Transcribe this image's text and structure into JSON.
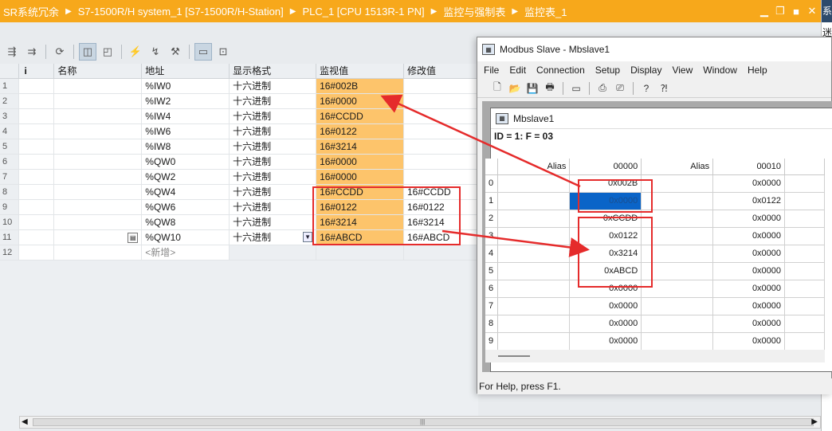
{
  "tia": {
    "title_crumbs": [
      "SR系统冗余",
      "S7-1500R/H system_1 [S7-1500R/H-Station]",
      "PLC_1 [CPU 1513R-1 PN]",
      "监控与强制表",
      "监控表_1"
    ],
    "right_edge_top": "系",
    "right_edge_char": "迷",
    "columns": {
      "info": "i",
      "name": "名称",
      "address": "地址",
      "format": "显示格式",
      "monitor": "监视值",
      "modify": "修改值"
    },
    "rows": [
      {
        "n": "1",
        "address": "%IW0",
        "format": "十六进制",
        "monitor": "16#002B",
        "modify": ""
      },
      {
        "n": "2",
        "address": "%IW2",
        "format": "十六进制",
        "monitor": "16#0000",
        "modify": ""
      },
      {
        "n": "3",
        "address": "%IW4",
        "format": "十六进制",
        "monitor": "16#CCDD",
        "modify": ""
      },
      {
        "n": "4",
        "address": "%IW6",
        "format": "十六进制",
        "monitor": "16#0122",
        "modify": ""
      },
      {
        "n": "5",
        "address": "%IW8",
        "format": "十六进制",
        "monitor": "16#3214",
        "modify": ""
      },
      {
        "n": "6",
        "address": "%QW0",
        "format": "十六进制",
        "monitor": "16#0000",
        "modify": ""
      },
      {
        "n": "7",
        "address": "%QW2",
        "format": "十六进制",
        "monitor": "16#0000",
        "modify": ""
      },
      {
        "n": "8",
        "address": "%QW4",
        "format": "十六进制",
        "monitor": "16#CCDD",
        "modify": "16#CCDD"
      },
      {
        "n": "9",
        "address": "%QW6",
        "format": "十六进制",
        "monitor": "16#0122",
        "modify": "16#0122"
      },
      {
        "n": "10",
        "address": "%QW8",
        "format": "十六进制",
        "monitor": "16#3214",
        "modify": "16#3214"
      },
      {
        "n": "11",
        "address": "%QW10",
        "format": "十六进制",
        "monitor": "16#ABCD",
        "modify": "16#ABCD"
      }
    ],
    "new_row": {
      "n": "12",
      "label": "<新增>"
    },
    "scroll_grip": "|||"
  },
  "modbus": {
    "window_title": "Modbus Slave - Mbslave1",
    "menu": [
      "File",
      "Edit",
      "Connection",
      "Setup",
      "Display",
      "View",
      "Window",
      "Help"
    ],
    "child_title": "Mbslave1",
    "info_line": "ID = 1: F = 03",
    "grid_headers": {
      "alias1": "Alias",
      "col1": "00000",
      "alias2": "Alias",
      "col2": "00010"
    },
    "grid_rows": [
      {
        "r": "0",
        "v1": "0x002B",
        "v2": "0x0000"
      },
      {
        "r": "1",
        "v1": "0x0000",
        "v2": "0x0122"
      },
      {
        "r": "2",
        "v1": "0xCCDD",
        "v2": "0x0000"
      },
      {
        "r": "3",
        "v1": "0x0122",
        "v2": "0x0000"
      },
      {
        "r": "4",
        "v1": "0x3214",
        "v2": "0x0000"
      },
      {
        "r": "5",
        "v1": "0xABCD",
        "v2": "0x0000"
      },
      {
        "r": "6",
        "v1": "0x0000",
        "v2": "0x0000"
      },
      {
        "r": "7",
        "v1": "0x0000",
        "v2": "0x0000"
      },
      {
        "r": "8",
        "v1": "0x0000",
        "v2": "0x0000"
      },
      {
        "r": "9",
        "v1": "0x0000",
        "v2": "0x0000"
      }
    ],
    "status": "For Help, press F1."
  },
  "colors": {
    "tia_title": "#f7a81b",
    "monitor_cell": "#fdc46b",
    "highlight": "#e52b2b",
    "selected_cell": "#0a64c8"
  }
}
